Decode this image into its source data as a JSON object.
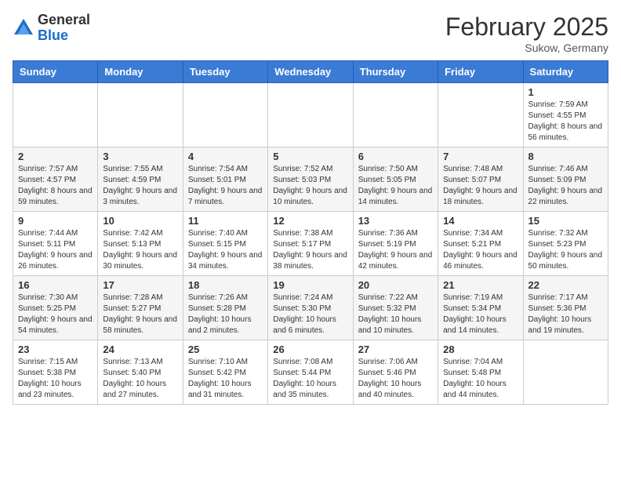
{
  "header": {
    "logo_general": "General",
    "logo_blue": "Blue",
    "month_title": "February 2025",
    "location": "Sukow, Germany"
  },
  "weekdays": [
    "Sunday",
    "Monday",
    "Tuesday",
    "Wednesday",
    "Thursday",
    "Friday",
    "Saturday"
  ],
  "weeks": [
    [
      {
        "day": "",
        "info": ""
      },
      {
        "day": "",
        "info": ""
      },
      {
        "day": "",
        "info": ""
      },
      {
        "day": "",
        "info": ""
      },
      {
        "day": "",
        "info": ""
      },
      {
        "day": "",
        "info": ""
      },
      {
        "day": "1",
        "info": "Sunrise: 7:59 AM\nSunset: 4:55 PM\nDaylight: 8 hours and 56 minutes."
      }
    ],
    [
      {
        "day": "2",
        "info": "Sunrise: 7:57 AM\nSunset: 4:57 PM\nDaylight: 8 hours and 59 minutes."
      },
      {
        "day": "3",
        "info": "Sunrise: 7:55 AM\nSunset: 4:59 PM\nDaylight: 9 hours and 3 minutes."
      },
      {
        "day": "4",
        "info": "Sunrise: 7:54 AM\nSunset: 5:01 PM\nDaylight: 9 hours and 7 minutes."
      },
      {
        "day": "5",
        "info": "Sunrise: 7:52 AM\nSunset: 5:03 PM\nDaylight: 9 hours and 10 minutes."
      },
      {
        "day": "6",
        "info": "Sunrise: 7:50 AM\nSunset: 5:05 PM\nDaylight: 9 hours and 14 minutes."
      },
      {
        "day": "7",
        "info": "Sunrise: 7:48 AM\nSunset: 5:07 PM\nDaylight: 9 hours and 18 minutes."
      },
      {
        "day": "8",
        "info": "Sunrise: 7:46 AM\nSunset: 5:09 PM\nDaylight: 9 hours and 22 minutes."
      }
    ],
    [
      {
        "day": "9",
        "info": "Sunrise: 7:44 AM\nSunset: 5:11 PM\nDaylight: 9 hours and 26 minutes."
      },
      {
        "day": "10",
        "info": "Sunrise: 7:42 AM\nSunset: 5:13 PM\nDaylight: 9 hours and 30 minutes."
      },
      {
        "day": "11",
        "info": "Sunrise: 7:40 AM\nSunset: 5:15 PM\nDaylight: 9 hours and 34 minutes."
      },
      {
        "day": "12",
        "info": "Sunrise: 7:38 AM\nSunset: 5:17 PM\nDaylight: 9 hours and 38 minutes."
      },
      {
        "day": "13",
        "info": "Sunrise: 7:36 AM\nSunset: 5:19 PM\nDaylight: 9 hours and 42 minutes."
      },
      {
        "day": "14",
        "info": "Sunrise: 7:34 AM\nSunset: 5:21 PM\nDaylight: 9 hours and 46 minutes."
      },
      {
        "day": "15",
        "info": "Sunrise: 7:32 AM\nSunset: 5:23 PM\nDaylight: 9 hours and 50 minutes."
      }
    ],
    [
      {
        "day": "16",
        "info": "Sunrise: 7:30 AM\nSunset: 5:25 PM\nDaylight: 9 hours and 54 minutes."
      },
      {
        "day": "17",
        "info": "Sunrise: 7:28 AM\nSunset: 5:27 PM\nDaylight: 9 hours and 58 minutes."
      },
      {
        "day": "18",
        "info": "Sunrise: 7:26 AM\nSunset: 5:28 PM\nDaylight: 10 hours and 2 minutes."
      },
      {
        "day": "19",
        "info": "Sunrise: 7:24 AM\nSunset: 5:30 PM\nDaylight: 10 hours and 6 minutes."
      },
      {
        "day": "20",
        "info": "Sunrise: 7:22 AM\nSunset: 5:32 PM\nDaylight: 10 hours and 10 minutes."
      },
      {
        "day": "21",
        "info": "Sunrise: 7:19 AM\nSunset: 5:34 PM\nDaylight: 10 hours and 14 minutes."
      },
      {
        "day": "22",
        "info": "Sunrise: 7:17 AM\nSunset: 5:36 PM\nDaylight: 10 hours and 19 minutes."
      }
    ],
    [
      {
        "day": "23",
        "info": "Sunrise: 7:15 AM\nSunset: 5:38 PM\nDaylight: 10 hours and 23 minutes."
      },
      {
        "day": "24",
        "info": "Sunrise: 7:13 AM\nSunset: 5:40 PM\nDaylight: 10 hours and 27 minutes."
      },
      {
        "day": "25",
        "info": "Sunrise: 7:10 AM\nSunset: 5:42 PM\nDaylight: 10 hours and 31 minutes."
      },
      {
        "day": "26",
        "info": "Sunrise: 7:08 AM\nSunset: 5:44 PM\nDaylight: 10 hours and 35 minutes."
      },
      {
        "day": "27",
        "info": "Sunrise: 7:06 AM\nSunset: 5:46 PM\nDaylight: 10 hours and 40 minutes."
      },
      {
        "day": "28",
        "info": "Sunrise: 7:04 AM\nSunset: 5:48 PM\nDaylight: 10 hours and 44 minutes."
      },
      {
        "day": "",
        "info": ""
      }
    ]
  ]
}
